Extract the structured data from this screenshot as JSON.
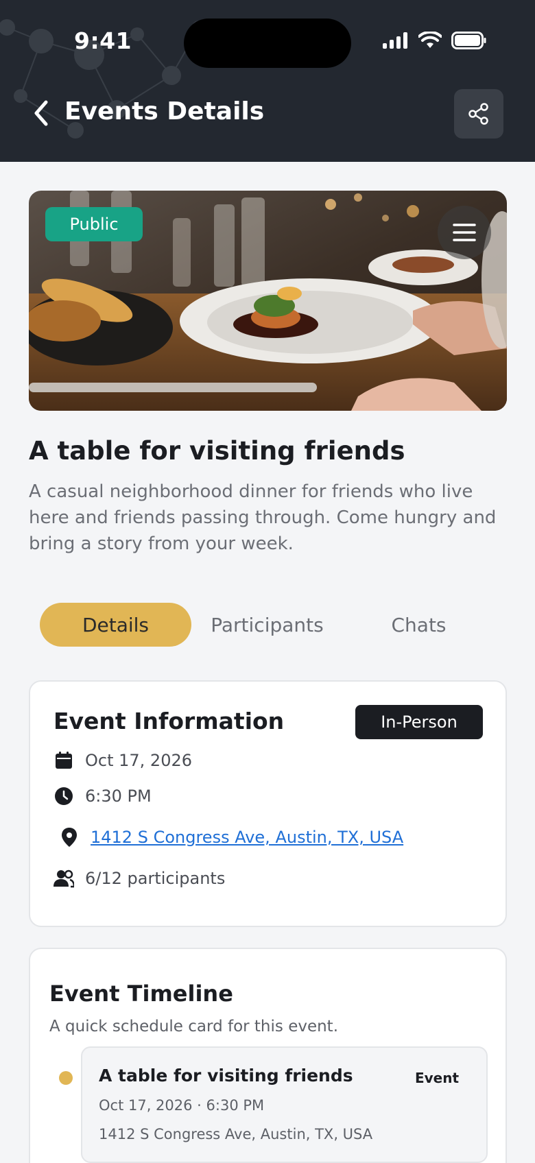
{
  "status_bar": {
    "time": "9:41"
  },
  "header": {
    "title": "Events Details",
    "back_icon": "chevron-left-icon",
    "share_icon": "share-icon"
  },
  "hero": {
    "visibility_badge": "Public",
    "menu_icon": "menu-icon"
  },
  "event": {
    "title": "A table for visiting friends",
    "description": "A casual neighborhood dinner for friends who live here and friends passing through. Come hungry and bring a story from your week."
  },
  "tabs": [
    {
      "label": "Details",
      "active": true
    },
    {
      "label": "Participants",
      "active": false
    },
    {
      "label": "Chats",
      "active": false
    }
  ],
  "info_card": {
    "title": "Event Information",
    "mode": "In-Person",
    "date": "Oct 17, 2026",
    "time": "6:30 PM",
    "address": "1412 S Congress Ave, Austin, TX, USA",
    "participants": "6/12 participants"
  },
  "timeline": {
    "title": "Event Timeline",
    "subtitle": "A quick schedule card for this event.",
    "items": [
      {
        "title": "A table for visiting friends",
        "tag": "Event",
        "datetime": "Oct 17, 2026 · 6:30 PM",
        "address": "1412 S Congress Ave, Austin, TX, USA"
      }
    ]
  },
  "colors": {
    "accent": "#e1b655",
    "header_bg": "#232830",
    "badge_green": "#18a386",
    "link": "#1f6fd6"
  }
}
